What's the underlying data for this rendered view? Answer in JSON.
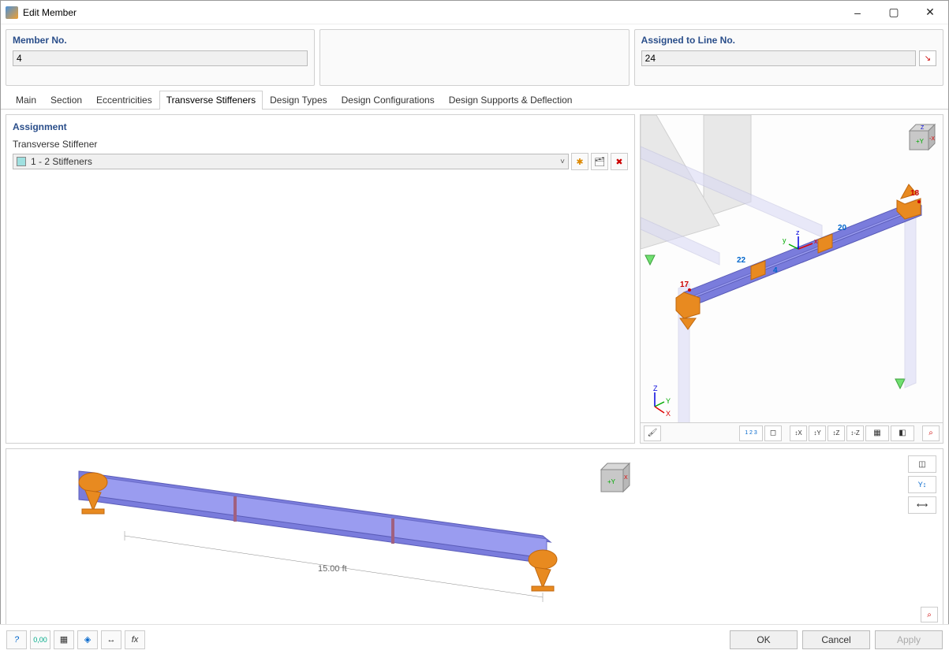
{
  "window": {
    "title": "Edit Member",
    "minimize": "–",
    "maximize": "▢",
    "close": "✕"
  },
  "header": {
    "member_no_label": "Member No.",
    "member_no_value": "4",
    "assigned_label": "Assigned to Line No.",
    "assigned_value": "24"
  },
  "tabs": {
    "items": [
      "Main",
      "Section",
      "Eccentricities",
      "Transverse Stiffeners",
      "Design Types",
      "Design Configurations",
      "Design Supports & Deflection"
    ],
    "active_index": 3
  },
  "assignment": {
    "section_title": "Assignment",
    "field_label": "Transverse Stiffener",
    "combo_value": "1 - 2 Stiffeners"
  },
  "icons": {
    "pick_line": "↘",
    "new": "✱",
    "library": "🗂",
    "delete": "✖",
    "chevron": "˅",
    "render": "🖌",
    "numbers": "1 2 3",
    "select_view": "◻",
    "axis_x": "↕X",
    "axis_y": "↕Y",
    "axis_z": "↕Z",
    "iso_z": "↕‑Z",
    "display": "▦",
    "solid": "◧",
    "zoom_reset": "⌕",
    "cube": "◫",
    "show_y": "Y↕",
    "dims": "⟷",
    "help": "?",
    "units": "0,00",
    "colors": "▦",
    "view_tool": "◈",
    "dim_tool": "↔",
    "fx": "fx"
  },
  "viewport": {
    "axis_labels": {
      "x": "X",
      "y": "Y",
      "z": "Z"
    },
    "node_labels": {
      "n17": "17",
      "n18": "18",
      "n20": "20",
      "n22": "22",
      "m4": "4"
    },
    "local_axes": {
      "x": "x",
      "y": "y",
      "z": "z"
    }
  },
  "beam_preview": {
    "dimension": "15.00 ft"
  },
  "footer": {
    "ok": "OK",
    "cancel": "Cancel",
    "apply": "Apply"
  }
}
